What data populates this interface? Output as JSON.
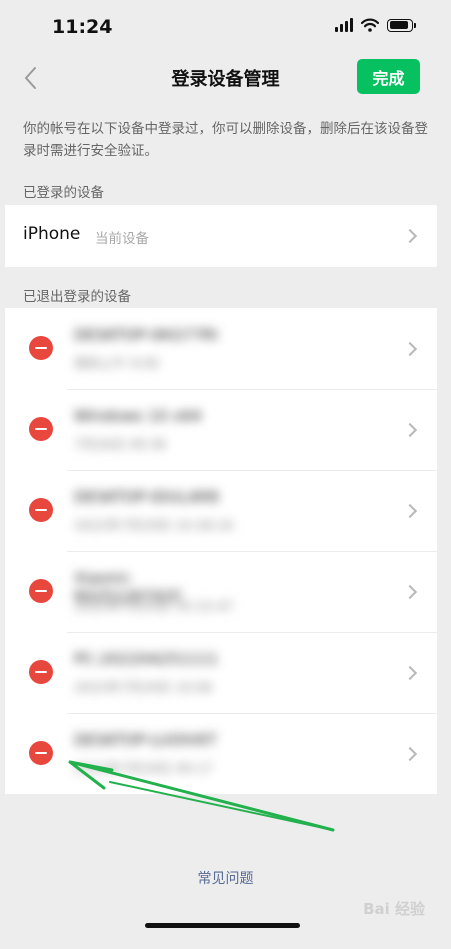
{
  "status_bar": {
    "time": "11:24",
    "battery_level": 0.9
  },
  "nav": {
    "title": "登录设备管理",
    "done_label": "完成"
  },
  "description": "你的帐号在以下设备中登录过，你可以删除设备，删除后在该设备登录时需进行安全验证。",
  "logged_in": {
    "header": "已登录的设备",
    "device": {
      "name": "iPhone",
      "tag": "当前设备"
    }
  },
  "logged_out": {
    "header": "已退出登录的设备",
    "devices": [
      {
        "name": "DESKTOP-0KG77RI",
        "time": "周四上午 9:00"
      },
      {
        "name": "Windows 10 x64",
        "time": "7月26日 09:36"
      },
      {
        "name": "DESKTOP-IDULAR8",
        "time": "2022年7月29日 10:28:16"
      },
      {
        "name": "Xiaomi-6025126742C",
        "time": "2022年7月29日 10:15:47"
      },
      {
        "name": "PC-202204251111",
        "time": "2022年7月29日 10:06"
      },
      {
        "name": "DESKTOP-LUOIV6T",
        "time": "2022年7月29日 09:17"
      }
    ]
  },
  "faq_label": "常见问题",
  "watermark": "Bai 经验",
  "colors": {
    "accent": "#07c160",
    "danger": "#e8473e",
    "link": "#576b95",
    "annotation": "#22b14c"
  },
  "icons": [
    "back-chevron-icon",
    "signal-icon",
    "wifi-icon",
    "battery-icon",
    "remove-circle-icon",
    "chevron-right-icon"
  ]
}
